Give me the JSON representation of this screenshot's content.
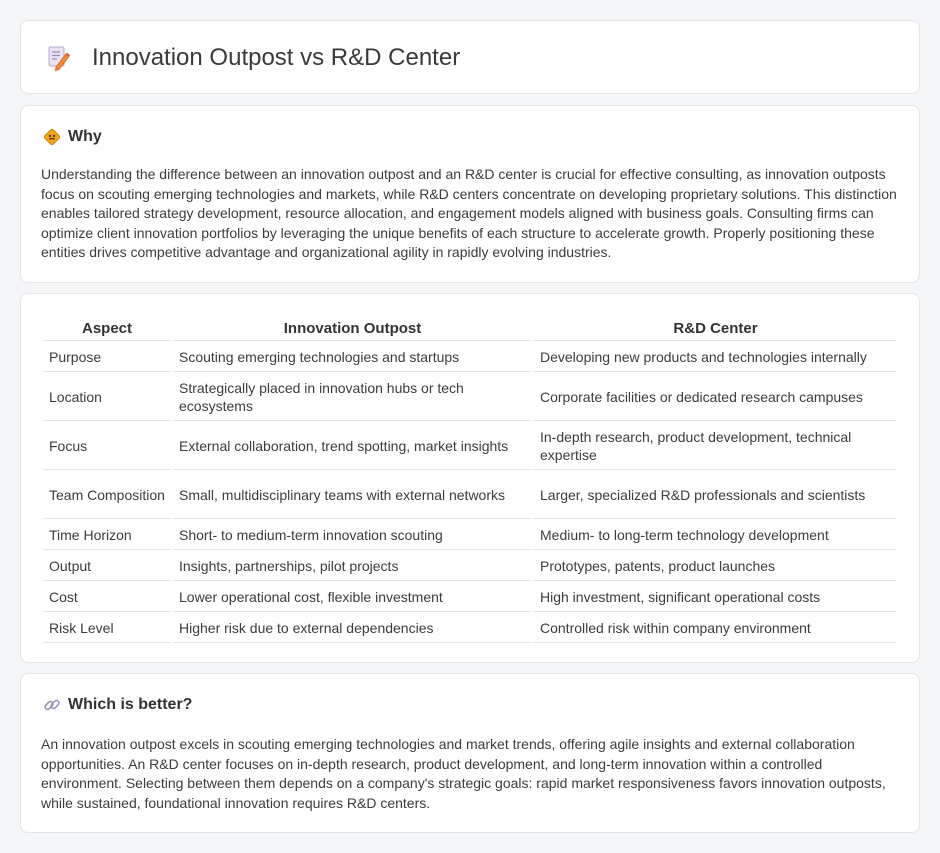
{
  "header": {
    "title": "Innovation Outpost vs R&D Center",
    "icon": "document-edit-icon"
  },
  "why": {
    "heading": "Why",
    "icon": "diamond-sign-icon",
    "text": "Understanding the difference between an innovation outpost and an R&D center is crucial for effective consulting, as innovation outposts focus on scouting emerging technologies and markets, while R&D centers concentrate on developing proprietary solutions. This distinction enables tailored strategy development, resource allocation, and engagement models aligned with business goals. Consulting firms can optimize client innovation portfolios by leveraging the unique benefits of each structure to accelerate growth. Properly positioning these entities drives competitive advantage and organizational agility in rapidly evolving industries."
  },
  "comparison": {
    "headers": [
      "Aspect",
      "Innovation Outpost",
      "R&D Center"
    ],
    "rows": [
      [
        "Purpose",
        "Scouting emerging technologies and startups",
        "Developing new products and technologies internally"
      ],
      [
        "Location",
        "Strategically placed in innovation hubs or tech ecosystems",
        "Corporate facilities or dedicated research campuses"
      ],
      [
        "Focus",
        "External collaboration, trend spotting, market insights",
        "In-depth research, product development, technical expertise"
      ],
      [
        "Team Composition",
        "Small, multidisciplinary teams with external networks",
        "Larger, specialized R&D professionals and scientists"
      ],
      [
        "Time Horizon",
        "Short- to medium-term innovation scouting",
        "Medium- to long-term technology development"
      ],
      [
        "Output",
        "Insights, partnerships, pilot projects",
        "Prototypes, patents, product launches"
      ],
      [
        "Cost",
        "Lower operational cost, flexible investment",
        "High investment, significant operational costs"
      ],
      [
        "Risk Level",
        "Higher risk due to external dependencies",
        "Controlled risk within company environment"
      ]
    ]
  },
  "better": {
    "heading": "Which is better?",
    "icon": "link-icon",
    "text": "An innovation outpost excels in scouting emerging technologies and market trends, offering agile insights and external collaboration opportunities. An R&D center focuses on in-depth research, product development, and long-term innovation within a controlled environment. Selecting between them depends on a company's strategic goals: rapid market responsiveness favors innovation outposts, while sustained, foundational innovation requires R&D centers."
  }
}
